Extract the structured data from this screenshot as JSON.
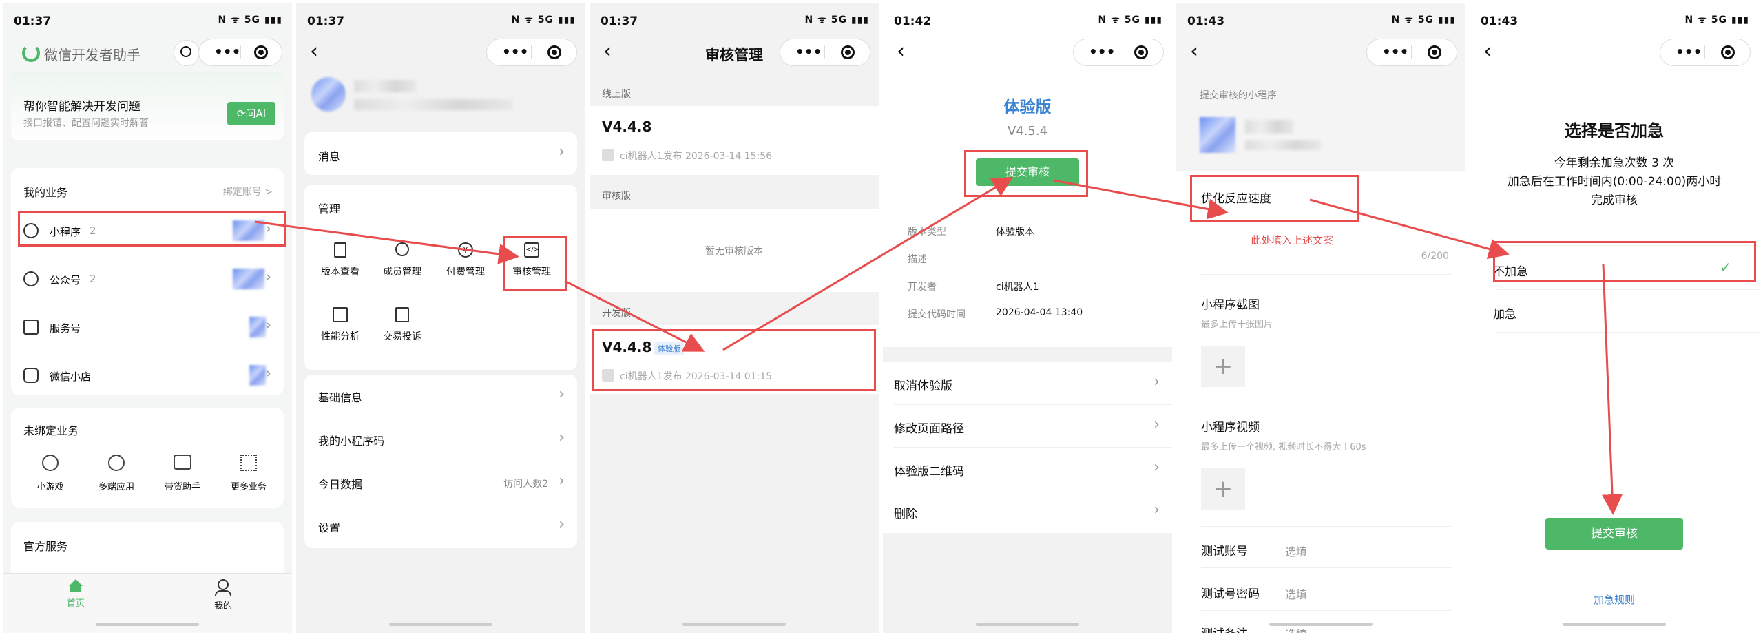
{
  "colors": {
    "accent_green": "#4cb868",
    "annotation_red": "#e84c4c",
    "link_blue": "#3a83d1"
  },
  "screen1": {
    "time": "01:37",
    "status_icons": "N ᯤ 5G ▮▮▮",
    "app_title": "微信开发者助手",
    "ai_card": {
      "title": "帮你智能解决开发问题",
      "subtitle": "接口报错、配置问题实时解答",
      "button": "问AI"
    },
    "my_business": {
      "header": "我的业务",
      "bind_link": "绑定账号 >",
      "items": [
        {
          "label": "小程序",
          "count": "2"
        },
        {
          "label": "公众号",
          "count": "2"
        },
        {
          "label": "服务号",
          "count": ""
        },
        {
          "label": "微信小店",
          "count": ""
        }
      ]
    },
    "unbound": {
      "header": "未绑定业务",
      "items": [
        "小游戏",
        "多端应用",
        "带货助手",
        "更多业务"
      ]
    },
    "official": {
      "header": "官方服务"
    },
    "tabs": [
      {
        "label": "首页"
      },
      {
        "label": "我的"
      }
    ]
  },
  "screen2": {
    "time": "01:37",
    "status_icons": "N ᯤ 5G ▮▮▮",
    "message": "消息",
    "manage": {
      "header": "管理",
      "items": [
        "版本查看",
        "成员管理",
        "付费管理",
        "审核管理",
        "性能分析",
        "交易投诉"
      ]
    },
    "list": [
      {
        "label": "基础信息",
        "value": ""
      },
      {
        "label": "我的小程序码",
        "value": ""
      },
      {
        "label": "今日数据",
        "value": "访问人数2"
      },
      {
        "label": "设置",
        "value": ""
      }
    ]
  },
  "screen3": {
    "time": "01:37",
    "status_icons": "N ᯤ 5G ▮▮▮",
    "title": "审核管理",
    "online": {
      "header": "线上版",
      "version": "V4.4.8",
      "meta": "ci机器人1发布  2026-03-14 15:56"
    },
    "review": {
      "header": "审核版",
      "empty": "暂无审核版本"
    },
    "dev": {
      "header": "开发版",
      "version": "V4.4.8",
      "tag": "体验版",
      "meta": "ci机器人1发布  2026-03-14 01:15"
    }
  },
  "screen4": {
    "time": "01:42",
    "status_icons": "N ᯤ 5G ▮▮▮",
    "title": "体验版",
    "version": "V4.5.4",
    "submit": "提交审核",
    "info": [
      {
        "k": "版本类型",
        "v": "体验版本"
      },
      {
        "k": "描述",
        "v": ""
      },
      {
        "k": "开发者",
        "v": "ci机器人1"
      },
      {
        "k": "提交代码时间",
        "v": "2026-04-04 13:40"
      }
    ],
    "actions": [
      "取消体验版",
      "修改页面路径",
      "体验版二维码",
      "删除"
    ]
  },
  "screen5": {
    "time": "01:43",
    "status_icons": "N ᯤ 5G ▮▮▮",
    "section_label": "提交审核的小程序",
    "desc_value": "优化反应速度",
    "annotation": "此处填入上述文案",
    "counter": "6/200",
    "screenshot": {
      "title": "小程序截图",
      "hint": "最多上传十张图片"
    },
    "video": {
      "title": "小程序视频",
      "hint": "最多上传一个视频, 视频时长不得大于60s"
    },
    "fields": [
      {
        "k": "测试账号",
        "v": "选填"
      },
      {
        "k": "测试号密码",
        "v": "选填"
      },
      {
        "k": "测试备注",
        "v": "选填"
      }
    ]
  },
  "screen6": {
    "time": "01:43",
    "status_icons": "N ᯤ 5G ▮▮▮",
    "title": "选择是否加急",
    "desc1": "今年剩余加急次数 3 次",
    "desc2": "加急后在工作时间内(0:00-24:00)两小时",
    "desc3": "完成审核",
    "options": [
      "不加急",
      "加急"
    ],
    "submit": "提交审核",
    "rules": "加急规则"
  }
}
